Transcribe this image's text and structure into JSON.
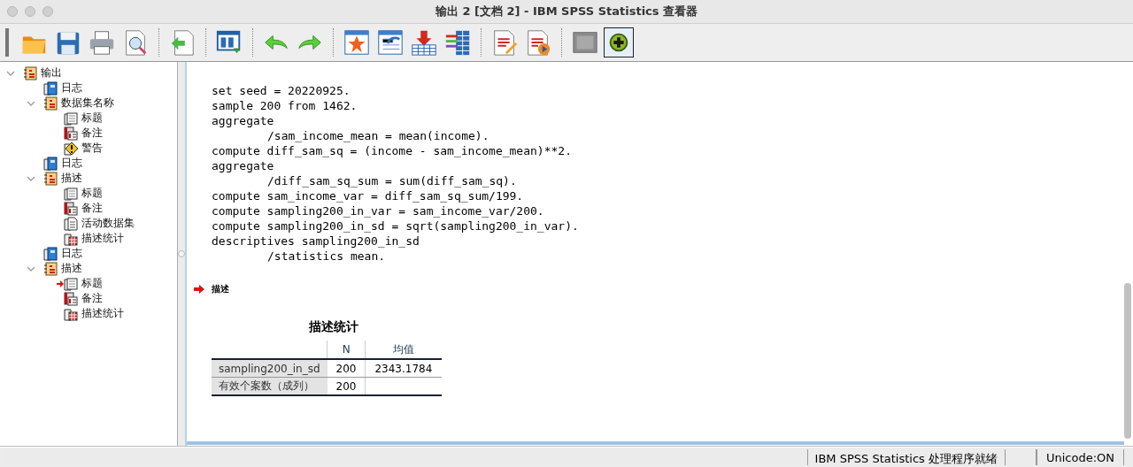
{
  "window": {
    "title": "输出 2 [文档 2] - IBM SPSS Statistics 查看器"
  },
  "outline": [
    {
      "label": "输出",
      "kind": "output",
      "expanded": true,
      "current": false,
      "children": [
        {
          "label": "日志",
          "kind": "log",
          "current": false
        },
        {
          "label": "数据集名称",
          "kind": "output",
          "expanded": true,
          "current": false,
          "children": [
            {
              "label": "标题",
              "kind": "title",
              "current": false
            },
            {
              "label": "备注",
              "kind": "note",
              "current": false
            },
            {
              "label": "警告",
              "kind": "warning",
              "current": false
            }
          ]
        },
        {
          "label": "日志",
          "kind": "log",
          "current": false
        },
        {
          "label": "描述",
          "kind": "output",
          "expanded": true,
          "current": false,
          "children": [
            {
              "label": "标题",
              "kind": "title",
              "current": false
            },
            {
              "label": "备注",
              "kind": "note",
              "current": false
            },
            {
              "label": "活动数据集",
              "kind": "text",
              "current": false
            },
            {
              "label": "描述统计",
              "kind": "table",
              "current": false
            }
          ]
        },
        {
          "label": "日志",
          "kind": "log",
          "current": false
        },
        {
          "label": "描述",
          "kind": "output",
          "expanded": true,
          "current": false,
          "children": [
            {
              "label": "标题",
              "kind": "title",
              "current": true
            },
            {
              "label": "备注",
              "kind": "note",
              "current": false
            },
            {
              "label": "描述统计",
              "kind": "table",
              "current": false
            }
          ]
        }
      ]
    }
  ],
  "log": [
    {
      "text": "set seed = 20220925.",
      "indented": false
    },
    {
      "text": "sample 200 from 1462.",
      "indented": false
    },
    {
      "text": "aggregate",
      "indented": false
    },
    {
      "text": "/sam_income_mean = mean(income).",
      "indented": true
    },
    {
      "text": "compute diff_sam_sq = (income - sam_income_mean)**2.",
      "indented": false
    },
    {
      "text": "aggregate",
      "indented": false
    },
    {
      "text": "/diff_sam_sq_sum = sum(diff_sam_sq).",
      "indented": true
    },
    {
      "text": "compute sam_income_var = diff_sam_sq_sum/199.",
      "indented": false
    },
    {
      "text": "compute sampling200_in_var = sam_income_var/200.",
      "indented": false
    },
    {
      "text": "compute sampling200_in_sd = sqrt(sampling200_in_var).",
      "indented": false
    },
    {
      "text": "descriptives sampling200_in_sd",
      "indented": false
    },
    {
      "text": "/statistics mean.",
      "indented": true
    }
  ],
  "section_heading": "描述",
  "table": {
    "title": "描述统计",
    "columns": [
      "N",
      "均值"
    ],
    "rows": [
      {
        "label": "sampling200_in_sd",
        "cells": [
          "200",
          "2343.1784"
        ]
      },
      {
        "label": "有效个案数（成列）",
        "cells": [
          "200",
          ""
        ]
      }
    ]
  },
  "status_bar": {
    "status": "IBM SPSS Statistics 处理程序就绪",
    "encoding": "Unicode:ON"
  }
}
